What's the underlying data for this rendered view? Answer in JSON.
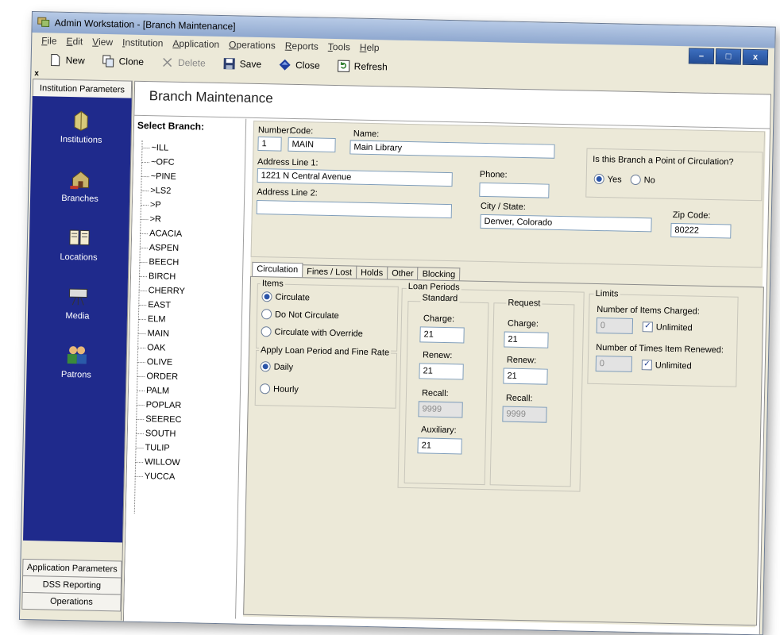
{
  "window": {
    "title": "Admin Workstation - [Branch Maintenance]",
    "controls": [
      "–",
      "□",
      "x"
    ]
  },
  "menu": [
    {
      "label": "File",
      "u": "F",
      "rest": "ile"
    },
    {
      "label": "Edit",
      "u": "E",
      "rest": "dit"
    },
    {
      "label": "View",
      "u": "V",
      "rest": "iew"
    },
    {
      "label": "Institution",
      "u": "I",
      "rest": "nstitution"
    },
    {
      "label": "Application",
      "u": "A",
      "rest": "pplication"
    },
    {
      "label": "Operations",
      "u": "O",
      "rest": "perations"
    },
    {
      "label": "Reports",
      "u": "R",
      "rest": "eports"
    },
    {
      "label": "Tools",
      "u": "T",
      "rest": "ools"
    },
    {
      "label": "Help",
      "u": "H",
      "rest": "elp"
    }
  ],
  "toolbar": {
    "new": "New",
    "clone": "Clone",
    "delete": "Delete",
    "save": "Save",
    "close": "Close",
    "refresh": "Refresh",
    "closebox": "x"
  },
  "nav": {
    "header": "Institution Parameters",
    "items": [
      "Institutions",
      "Branches",
      "Locations",
      "Media",
      "Patrons"
    ],
    "bottom": [
      "Application Parameters",
      "DSS Reporting",
      "Operations"
    ]
  },
  "page": {
    "title": "Branch Maintenance"
  },
  "branches": {
    "label": "Select Branch:",
    "items": [
      "~ILL",
      "~OFC",
      "~PINE",
      ">LS2",
      ">P",
      ">R",
      "ACACIA",
      "ASPEN",
      "BEECH",
      "BIRCH",
      "CHERRY",
      "EAST",
      "ELM",
      "MAIN",
      "OAK",
      "OLIVE",
      "ORDER",
      "PALM",
      "POPLAR",
      "SEEREC",
      "SOUTH",
      "TULIP",
      "WILLOW",
      "YUCCA"
    ]
  },
  "form": {
    "number_label": "Number:",
    "number": "1",
    "code_label": "Code:",
    "code": "MAIN",
    "name_label": "Name:",
    "name": "Main Library",
    "address1_label": "Address Line 1:",
    "address1": "1221 N Central Avenue",
    "address2_label": "Address Line 2:",
    "address2": "",
    "phone_label": "Phone:",
    "phone": "",
    "citystate_label": "City / State:",
    "citystate": "Denver, Colorado",
    "zip_label": "Zip Code:",
    "zip": "80222",
    "poc_question": "Is this Branch a Point of Circulation?",
    "poc_yes": "Yes",
    "poc_no": "No"
  },
  "tabs": [
    "Circulation",
    "Fines / Lost",
    "Holds",
    "Other",
    "Blocking"
  ],
  "circulation": {
    "items_title": "Items",
    "circulate": "Circulate",
    "do_not_circulate": "Do Not Circulate",
    "circulate_override": "Circulate with Override",
    "apply_title": "Apply Loan Period and Fine Rate",
    "daily": "Daily",
    "hourly": "Hourly",
    "loan_periods": "Loan Periods",
    "standard": "Standard",
    "request": "Request",
    "charge_label": "Charge:",
    "renew_label": "Renew:",
    "recall_label": "Recall:",
    "auxiliary_label": "Auxiliary:",
    "std_charge": "21",
    "std_renew": "21",
    "std_recall": "9999",
    "std_auxiliary": "21",
    "req_charge": "21",
    "req_renew": "21",
    "req_recall": "9999",
    "limits_title": "Limits",
    "items_charged_label": "Number of Items Charged:",
    "items_charged": "0",
    "unlimited": "Unlimited",
    "times_renewed_label": "Number of Times Item Renewed:",
    "times_renewed": "0"
  },
  "colors": {
    "nav_bg": "#1f2a8c",
    "title_bar": "#8fa8cf",
    "window_bg": "#ece9d8"
  }
}
